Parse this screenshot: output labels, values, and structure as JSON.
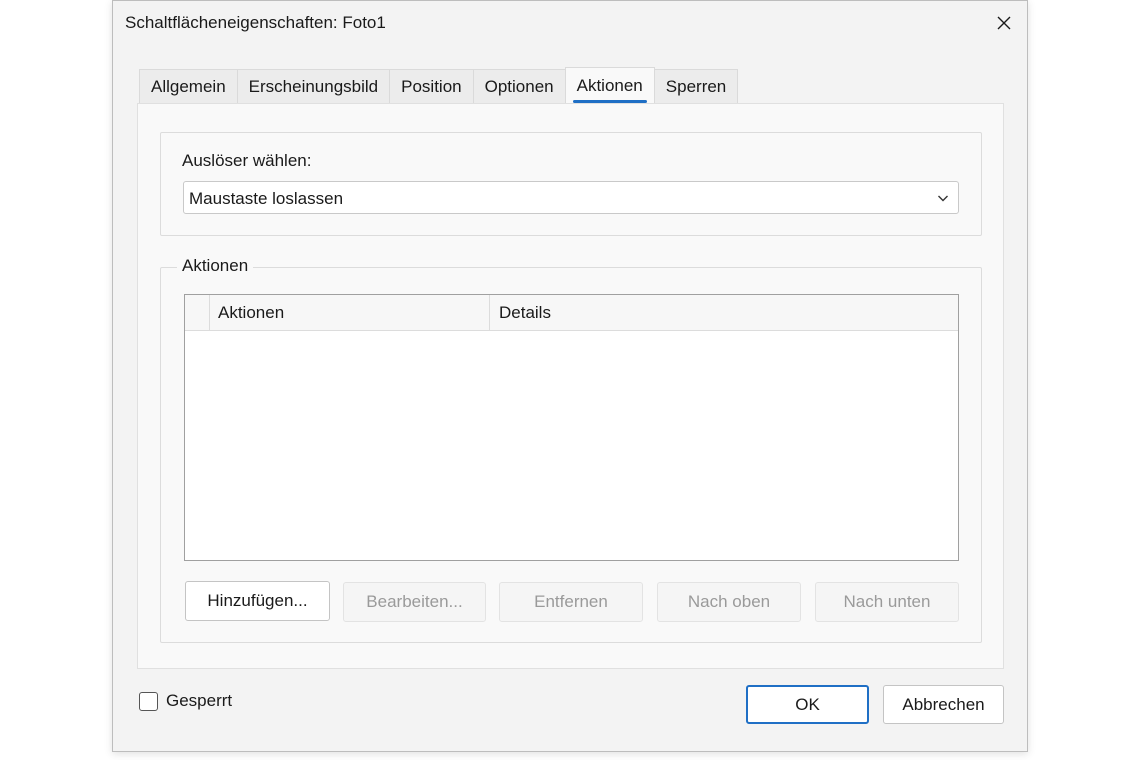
{
  "window": {
    "title": "Schaltflächeneigenschaften: Foto1",
    "close_icon": "close-icon"
  },
  "tabs": [
    {
      "label": "Allgemein",
      "active": false
    },
    {
      "label": "Erscheinungsbild",
      "active": false
    },
    {
      "label": "Position",
      "active": false
    },
    {
      "label": "Optionen",
      "active": false
    },
    {
      "label": "Aktionen",
      "active": true
    },
    {
      "label": "Sperren",
      "active": false
    }
  ],
  "trigger": {
    "label": "Auslöser wählen:",
    "selected": "Maustaste loslassen",
    "chevron_icon": "chevron-down-icon"
  },
  "actions_group": {
    "label": "Aktionen",
    "columns": [
      "Aktionen",
      "Details"
    ],
    "rows": []
  },
  "buttons": {
    "add": "Hinzufügen...",
    "edit": "Bearbeiten...",
    "remove": "Entfernen",
    "up": "Nach oben",
    "down": "Nach unten"
  },
  "footer": {
    "locked_label": "Gesperrt",
    "locked_checked": false,
    "ok": "OK",
    "cancel": "Abbrechen"
  },
  "colors": {
    "accent": "#1f6fc5",
    "dialog_bg": "#f3f3f3",
    "panel_bg": "#f9f9f9",
    "disabled_text": "#9a9a9a"
  }
}
